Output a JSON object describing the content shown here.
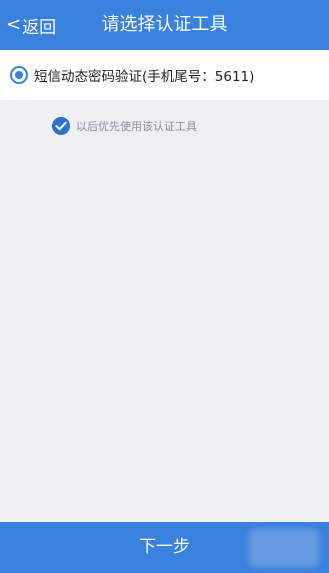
{
  "navbar": {
    "back_label": "返回",
    "title": "请选择认证工具"
  },
  "option": {
    "label": "短信动态密码验证(手机尾号：5611)",
    "selected": true
  },
  "remember": {
    "label": "以后优先使用该认证工具",
    "checked": true
  },
  "footer": {
    "next_label": "下一步"
  },
  "colors": {
    "accent": "#3a80dd",
    "background": "#eef0f6"
  }
}
